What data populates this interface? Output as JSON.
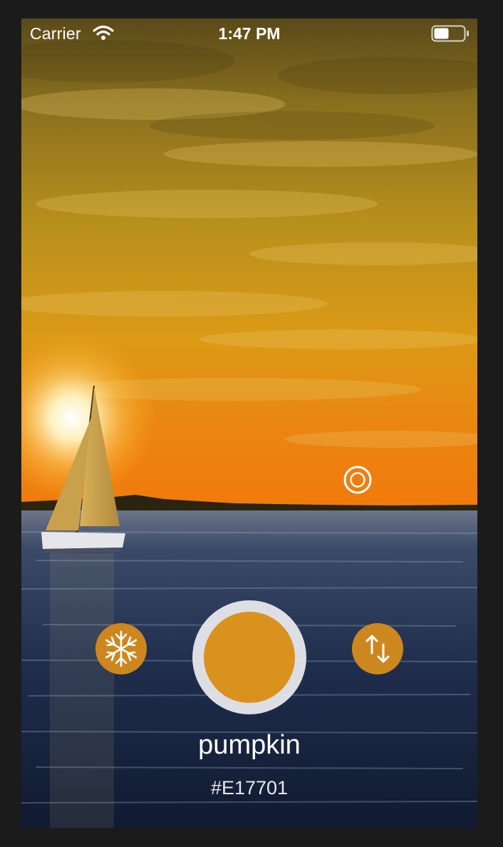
{
  "status_bar": {
    "carrier": "Carrier",
    "time": "1:47 PM",
    "wifi_icon": "wifi-icon",
    "battery_icon": "battery-icon",
    "battery_level": 0.5
  },
  "controls": {
    "freeze_icon": "snowflake-icon",
    "swap_icon": "swap-arrows-icon",
    "capture_icon": "capture-ring"
  },
  "picker": {
    "reticle_icon": "target-reticle-icon"
  },
  "color": {
    "name": "pumpkin",
    "hex": "#E17701",
    "swatch_color": "#DA921F"
  },
  "colors": {
    "control_fill": "#CD871E",
    "ring": "#ECECF0",
    "text": "#FFFFFF"
  }
}
